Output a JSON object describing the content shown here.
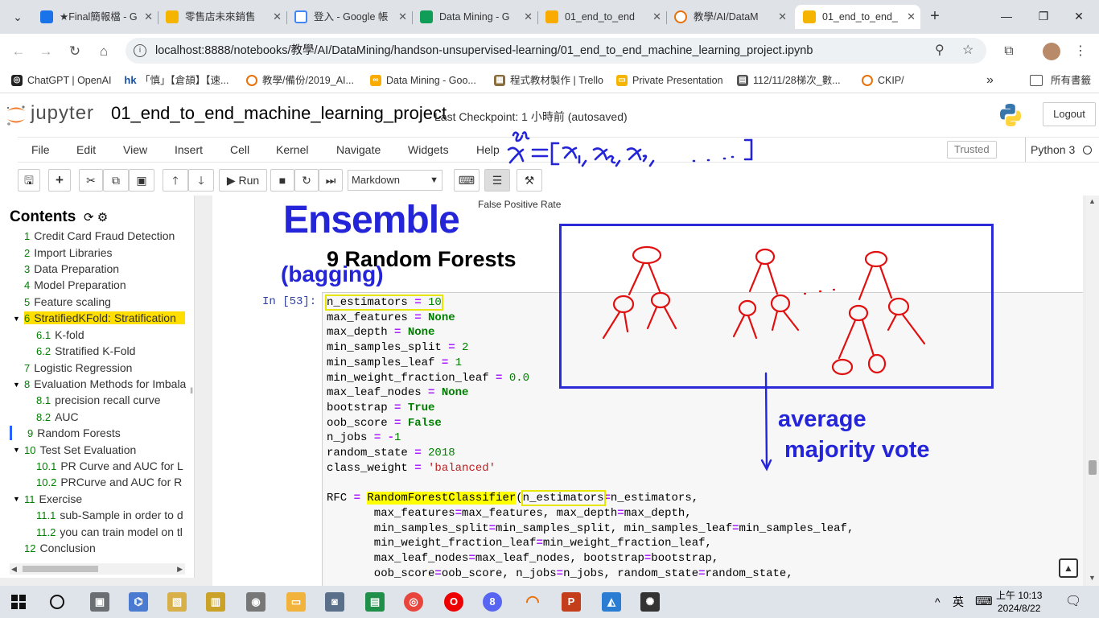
{
  "browser": {
    "tabs": [
      {
        "label": "★Final簡報檔 - G",
        "favicon_color": "#1a73e8"
      },
      {
        "label": "零售店未來銷售",
        "favicon_color": "#f4b400"
      },
      {
        "label": "登入 - Google 帳",
        "favicon_color": "#4285f4"
      },
      {
        "label": "Data Mining - G",
        "favicon_color": "#0f9d58"
      },
      {
        "label": "01_end_to_end",
        "favicon_color": "#f9ab00"
      },
      {
        "label": "教學/AI/DataM",
        "favicon_color": "#e8710a"
      },
      {
        "label": "01_end_to_end_",
        "favicon_color": "#f4b400"
      }
    ],
    "active_tab_index": 6,
    "url": "localhost:8888/notebooks/教學/AI/DataMining/handson-unsupervised-learning/01_end_to_end_machine_learning_project.ipynb",
    "bookmarks": [
      {
        "label": "ChatGPT | OpenAI",
        "icon": "chatgpt-icon",
        "color": "#222"
      },
      {
        "label": "「慎」【倉頡】【速...",
        "icon": "hk-icon",
        "color": "#1a4fa0"
      },
      {
        "label": "教學/備份/2019_AI...",
        "icon": "colab-icon",
        "color": "#e8710a"
      },
      {
        "label": "Data Mining - Goo...",
        "icon": "colab-icon",
        "color": "#f9ab00"
      },
      {
        "label": "程式教材製作 | Trello",
        "icon": "trello-icon",
        "color": "#8a6d3b"
      },
      {
        "label": "Private Presentation",
        "icon": "slides-icon",
        "color": "#f4b400"
      },
      {
        "label": "112/11/28梯次_數...",
        "icon": "doc-icon",
        "color": "#555"
      },
      {
        "label": "CKIP/",
        "icon": "colab-icon",
        "color": "#e8710a"
      }
    ],
    "bookmarks_more": "»",
    "all_bookmarks": "所有書籤"
  },
  "jupyter": {
    "logo_text": "jupyter",
    "notebook_name": "01_end_to_end_machine_learning_project",
    "checkpoint": "Last Checkpoint: 1 小時前   (autosaved)",
    "logout": "Logout",
    "menu": [
      "File",
      "Edit",
      "View",
      "Insert",
      "Cell",
      "Kernel",
      "Navigate",
      "Widgets",
      "Help"
    ],
    "trusted": "Trusted",
    "kernel": "Python 3",
    "run_label": "Run",
    "cell_type": "Markdown"
  },
  "toc": {
    "title": "Contents",
    "items": [
      {
        "num": "1",
        "label": "Credit Card Fraud Detection"
      },
      {
        "num": "2",
        "label": "Import Libraries"
      },
      {
        "num": "3",
        "label": "Data Preparation"
      },
      {
        "num": "4",
        "label": "Model Preparation"
      },
      {
        "num": "5",
        "label": "Feature scaling"
      },
      {
        "num": "6",
        "label": "StratifiedKFold: Stratification"
      },
      {
        "num": "6.1",
        "label": "K-fold"
      },
      {
        "num": "6.2",
        "label": "Stratified K-Fold"
      },
      {
        "num": "7",
        "label": "Logistic Regression"
      },
      {
        "num": "8",
        "label": "Evaluation Methods for Imbala"
      },
      {
        "num": "8.1",
        "label": "precision recall curve"
      },
      {
        "num": "8.2",
        "label": "AUC"
      },
      {
        "num": "9",
        "label": "Random Forests"
      },
      {
        "num": "10",
        "label": "Test Set Evaluation"
      },
      {
        "num": "10.1",
        "label": "PR Curve and AUC for L"
      },
      {
        "num": "10.2",
        "label": "PRCurve and AUC for R"
      },
      {
        "num": "11",
        "label": "Exercise"
      },
      {
        "num": "11.1",
        "label": "sub-Sample in order to d"
      },
      {
        "num": "11.2",
        "label": "you can train model on tl"
      },
      {
        "num": "12",
        "label": "Conclusion"
      }
    ]
  },
  "notebook": {
    "fpr_label": "False Positive Rate",
    "heading": "9  Random Forests",
    "prompt": "In [53]:"
  },
  "annotations": {
    "ensemble": "Ensemble",
    "bagging": "(bagging)",
    "average": "average",
    "majority_vote": "majority vote",
    "ink_color": "#2424d8",
    "tree_color": "#e01010"
  },
  "taskbar": {
    "ime": "英",
    "time": "上午 10:13",
    "date": "2024/8/22",
    "tray_up": "^"
  }
}
